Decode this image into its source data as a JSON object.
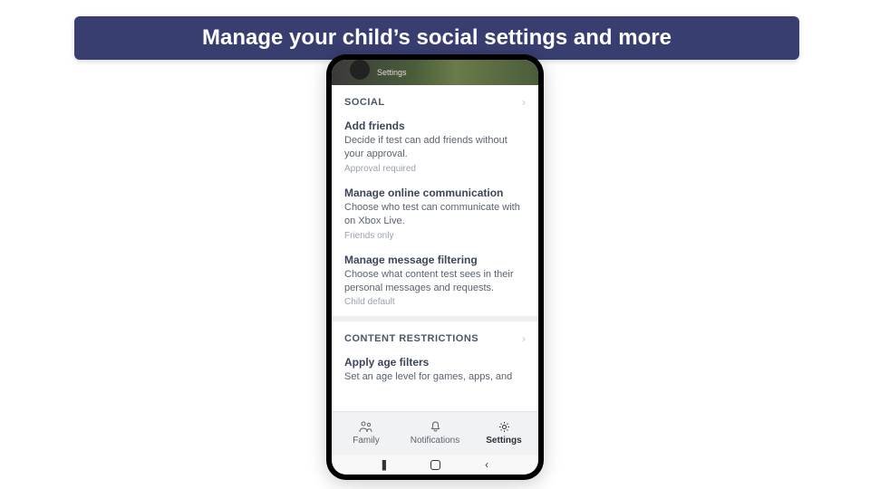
{
  "banner": "Manage your child’s social settings and more",
  "header_sub": "Settings",
  "sections": {
    "social": {
      "title": "SOCIAL",
      "items": [
        {
          "title": "Add friends",
          "desc": "Decide if test can add friends without your approval.",
          "value": "Approval required"
        },
        {
          "title": "Manage online communication",
          "desc": "Choose who test can communicate with on Xbox Live.",
          "value": "Friends only"
        },
        {
          "title": "Manage message filtering",
          "desc": "Choose what content test sees in their personal messages and requests.",
          "value": "Child default"
        }
      ]
    },
    "content": {
      "title": "CONTENT RESTRICTIONS",
      "items": [
        {
          "title": "Apply age filters",
          "desc": "Set an age level for games, apps, and",
          "value": ""
        }
      ]
    }
  },
  "nav": {
    "family": "Family",
    "notifications": "Notifications",
    "settings": "Settings"
  }
}
